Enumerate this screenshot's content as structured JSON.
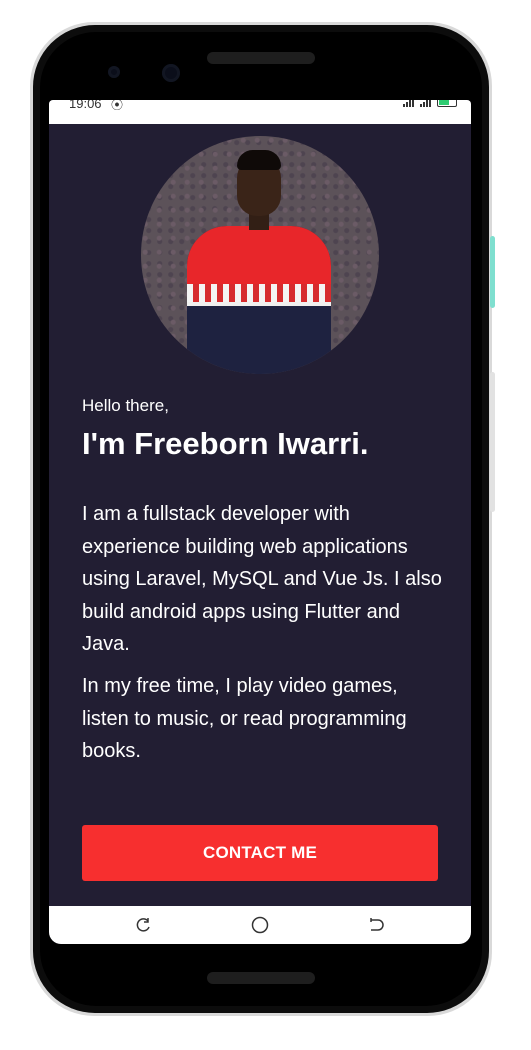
{
  "status_bar": {
    "time": "19:06",
    "dnd_icon": "do-not-disturb-icon",
    "signal_icons": [
      "signal-icon",
      "signal-icon"
    ],
    "battery_icon": "battery-charging-icon"
  },
  "profile": {
    "avatar_alt": "profile photo",
    "greeting": "Hello there,",
    "name": "I'm Freeborn Iwarri.",
    "bio_paragraph_1": "I am a fullstack developer with experience building web applications using Laravel, MySQL and Vue Js. I also build android apps using Flutter and Java.",
    "bio_paragraph_2": "In my free time, I play video games, listen to music, or read programming books."
  },
  "actions": {
    "contact_label": "CONTACT ME"
  },
  "nav_bar": {
    "recent_icon": "recent-apps-icon",
    "home_icon": "home-icon",
    "back_icon": "back-icon"
  },
  "colors": {
    "background": "#221e33",
    "accent": "#f72f2f",
    "text": "#ffffff"
  }
}
